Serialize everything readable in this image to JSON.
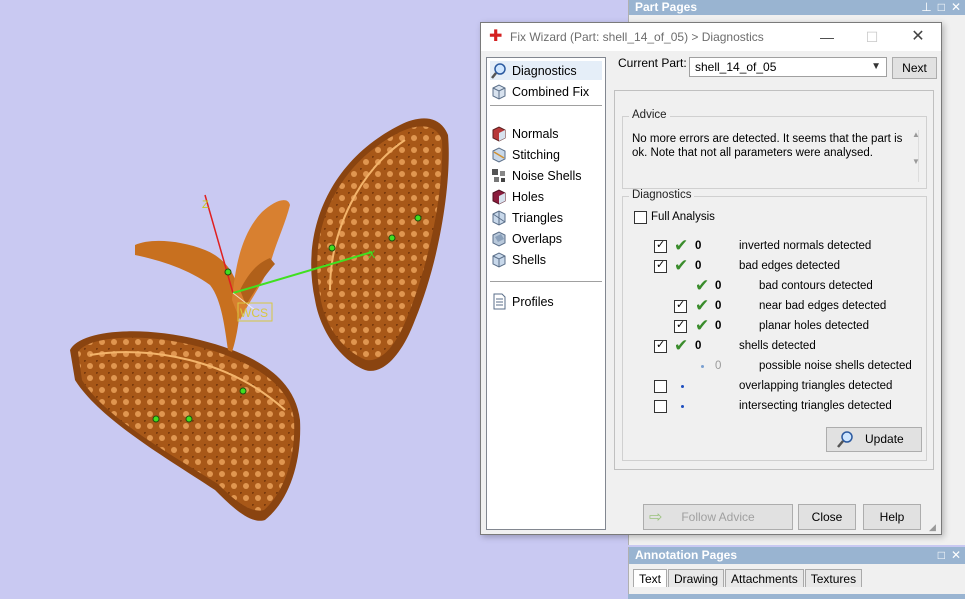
{
  "dialog": {
    "title": "Fix Wizard (Part: shell_14_of_05) > Diagnostics",
    "current_part_label": "Current Part:",
    "current_part_value": "shell_14_of_05",
    "next_label": "Next",
    "nav": [
      {
        "label": "Diagnostics",
        "icon": "magnifier-icon"
      },
      {
        "label": "Combined Fix",
        "icon": "cube-icon"
      },
      {
        "label": "Normals",
        "icon": "normals-cube-icon"
      },
      {
        "label": "Stitching",
        "icon": "stitching-cube-icon"
      },
      {
        "label": "Noise Shells",
        "icon": "noise-shells-icon"
      },
      {
        "label": "Holes",
        "icon": "holes-cube-icon"
      },
      {
        "label": "Triangles",
        "icon": "triangles-cube-icon"
      },
      {
        "label": "Overlaps",
        "icon": "overlaps-cube-icon"
      },
      {
        "label": "Shells",
        "icon": "shells-cube-icon"
      },
      {
        "label": "Profiles",
        "icon": "document-icon"
      }
    ],
    "advice_title": "Advice",
    "advice_text": "No more errors are detected. It seems that the part is ok. Note that not all parameters were analysed.",
    "diagnostics_title": "Diagnostics",
    "full_analysis_label": "Full Analysis",
    "rows": [
      {
        "count": "0",
        "label": "inverted normals detected"
      },
      {
        "count": "0",
        "label": "bad edges detected"
      },
      {
        "count": "0",
        "label": "bad contours detected"
      },
      {
        "count": "0",
        "label": "near bad edges detected"
      },
      {
        "count": "0",
        "label": "planar holes detected"
      },
      {
        "count": "0",
        "label": "shells detected"
      },
      {
        "count": "0",
        "label": "possible noise shells detected"
      },
      {
        "count": "",
        "label": "overlapping triangles detected"
      },
      {
        "count": "",
        "label": "intersecting triangles detected"
      }
    ],
    "update_label": "Update",
    "follow_advice_label": "Follow Advice",
    "close_label": "Close",
    "help_label": "Help"
  },
  "part_pages": {
    "title": "Part Pages"
  },
  "annotation_pages": {
    "title": "Annotation Pages",
    "tabs": [
      "Text",
      "Drawing",
      "Attachments",
      "Textures"
    ]
  },
  "viewport": {
    "wcs_label": "WCS",
    "axis_x": "X",
    "axis_z": "Z"
  },
  "colors": {
    "viewport_bg": "#c9c9f2",
    "model": "#b8641e",
    "panel_header": "#99b4d1",
    "check_green": "#3a8c2c"
  }
}
